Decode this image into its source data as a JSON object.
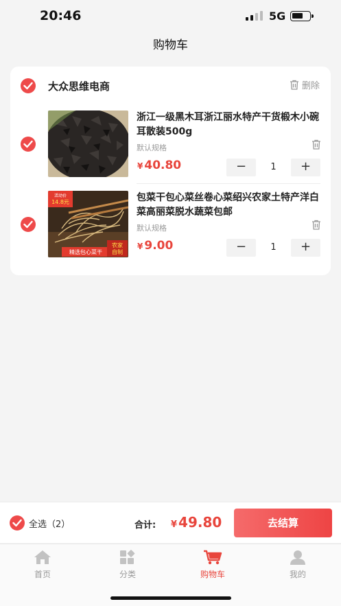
{
  "status_bar": {
    "time": "20:46",
    "network": "5G"
  },
  "nav": {
    "title": "购物车"
  },
  "shop": {
    "name": "大众思维电商",
    "delete_label": "删除",
    "items": [
      {
        "title": "浙江一级黑木耳浙江丽水特产干货椴木小碗耳散装500g",
        "spec": "默认规格",
        "currency": "¥",
        "price": "40.80",
        "quantity": "1",
        "minus": "−",
        "plus": "+"
      },
      {
        "title": "包菜干包心菜丝卷心菜绍兴农家土特产洋白菜高丽菜脱水蔬菜包邮",
        "spec": "默认规格",
        "currency": "¥",
        "price": "9.00",
        "quantity": "1",
        "minus": "−",
        "plus": "+",
        "image_badge_top": "活动价",
        "image_badge_price": "14.8元",
        "image_caption": "精选包心菜干",
        "image_tag_line1": "农家",
        "image_tag_line2": "自制"
      }
    ]
  },
  "footer": {
    "select_all_label": "全选",
    "selected_count": "（2）",
    "total_label": "合计:",
    "total_currency": "¥",
    "total_amount": "49.80",
    "checkout_label": "去结算"
  },
  "tabs": [
    {
      "label": "首页",
      "icon": "home-icon"
    },
    {
      "label": "分类",
      "icon": "category-icon"
    },
    {
      "label": "购物车",
      "icon": "cart-icon",
      "active": true
    },
    {
      "label": "我的",
      "icon": "profile-icon"
    }
  ],
  "colors": {
    "accent": "#e8453c",
    "check": "#ee4a4a",
    "checkout": "#ee4444"
  }
}
